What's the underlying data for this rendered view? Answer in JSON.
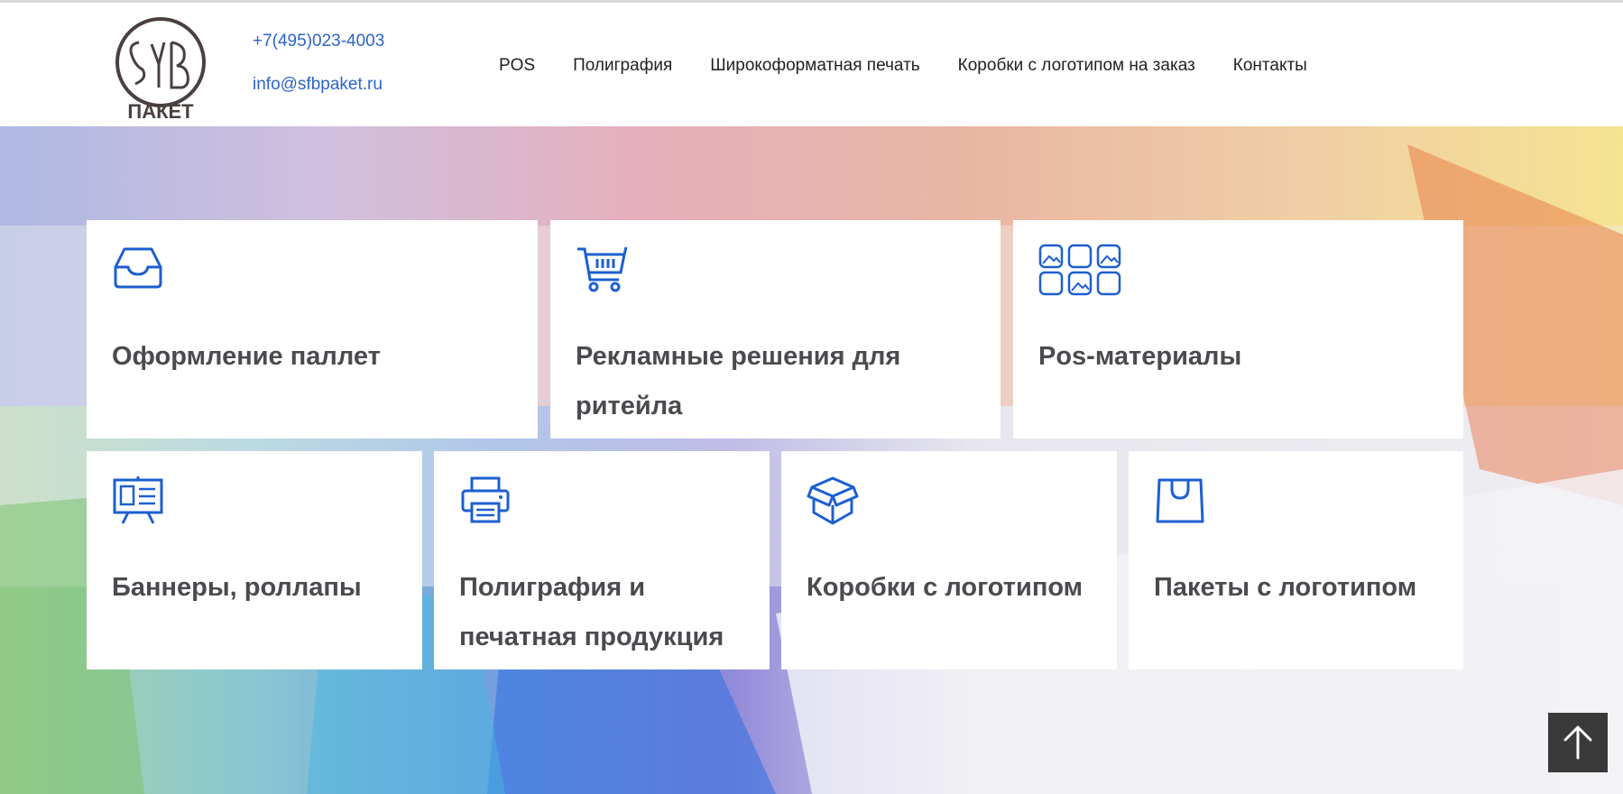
{
  "header": {
    "logo_text": "SFB ПАКЕТ",
    "phone": "+7(495)023-4003",
    "email": "info@sfbpaket.ru",
    "nav": [
      {
        "label": "POS"
      },
      {
        "label": "Полиграфия"
      },
      {
        "label": "Широкоформатная печать"
      },
      {
        "label": "Коробки с логотипом на заказ"
      },
      {
        "label": "Контакты"
      }
    ]
  },
  "cards": [
    {
      "title": "Оформление паллет",
      "icon": "inbox-tray-icon"
    },
    {
      "title": "Рекламные решения для ритейла",
      "icon": "shopping-cart-icon"
    },
    {
      "title": "Pos-материалы",
      "icon": "image-grid-icon"
    },
    {
      "title": "Баннеры, роллапы",
      "icon": "presentation-board-icon"
    },
    {
      "title": "Полиграфия и печатная продукция",
      "icon": "printer-icon"
    },
    {
      "title": "Коробки с логотипом",
      "icon": "box-icon"
    },
    {
      "title": "Пакеты с логотипом",
      "icon": "shopping-bag-icon"
    }
  ],
  "colors": {
    "accent": "#2b64c8",
    "icon": "#1d5fd1",
    "card_text": "#4a4a4f",
    "scroll_button": "#3a3a3a"
  },
  "scroll_top_icon": "arrow-up-icon"
}
